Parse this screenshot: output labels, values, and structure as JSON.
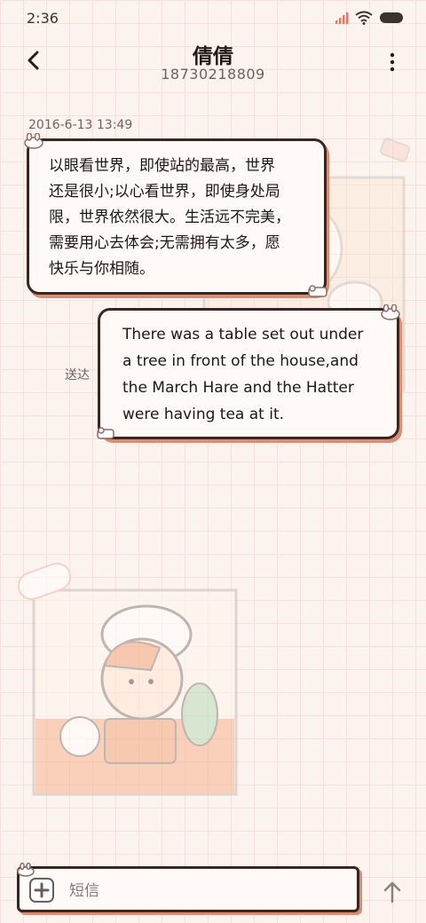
{
  "status_bar": {
    "time": "2:36",
    "icons": [
      "signal-icon",
      "wifi-icon",
      "battery-icon"
    ]
  },
  "header": {
    "contact_name": "倩倩",
    "contact_number": "18730218809",
    "back_icon": "chevron-left-icon",
    "menu_icon": "more-vertical-icon"
  },
  "conversation": {
    "timestamp": "2016-6-13 13:49",
    "messages": [
      {
        "direction": "incoming",
        "lines": [
          "以眼看世界，即使站的最高，世界",
          "还是很小;以心看世界，即使身处局",
          "限，世界依然很大。生活远不完美，",
          "需要用心去体会;无需拥有太多，愿",
          "快乐与你相随。"
        ]
      },
      {
        "direction": "outgoing",
        "status": "送达",
        "lines": [
          "There was a table set out under",
          "a tree in front of the house,and",
          "the March Hare and the Hatter",
          "were having tea at it."
        ]
      }
    ]
  },
  "composer": {
    "placeholder": "短信",
    "attach_icon": "add-attachment-icon",
    "send_icon": "arrow-up-icon"
  },
  "colors": {
    "background": "#fdf3ee",
    "bubble_border": "#3a2521",
    "bubble_shadow": "#d98d73",
    "bubble_fill": "#fffaf7"
  }
}
